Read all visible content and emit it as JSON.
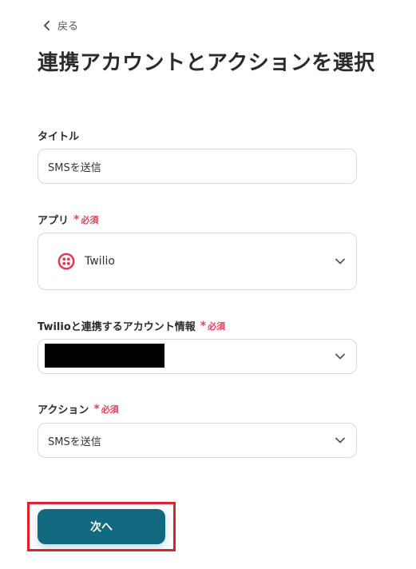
{
  "header": {
    "back_label": "戻る",
    "page_title": "連携アカウントとアクションを選択"
  },
  "form": {
    "title_field": {
      "label": "タイトル",
      "value": "SMSを送信"
    },
    "app_field": {
      "label": "アプリ",
      "required_label": "必須",
      "value": "Twilio",
      "icon": "twilio-logo-icon"
    },
    "account_field": {
      "label": "Twilioと連携するアカウント情報",
      "required_label": "必須"
    },
    "action_field": {
      "label": "アクション",
      "required_label": "必須",
      "value": "SMSを送信"
    },
    "next_button_label": "次へ"
  },
  "colors": {
    "accent": "#116a7f",
    "required": "#e8405a",
    "highlight": "#e0202e",
    "twilio_red": "#e8334a"
  }
}
